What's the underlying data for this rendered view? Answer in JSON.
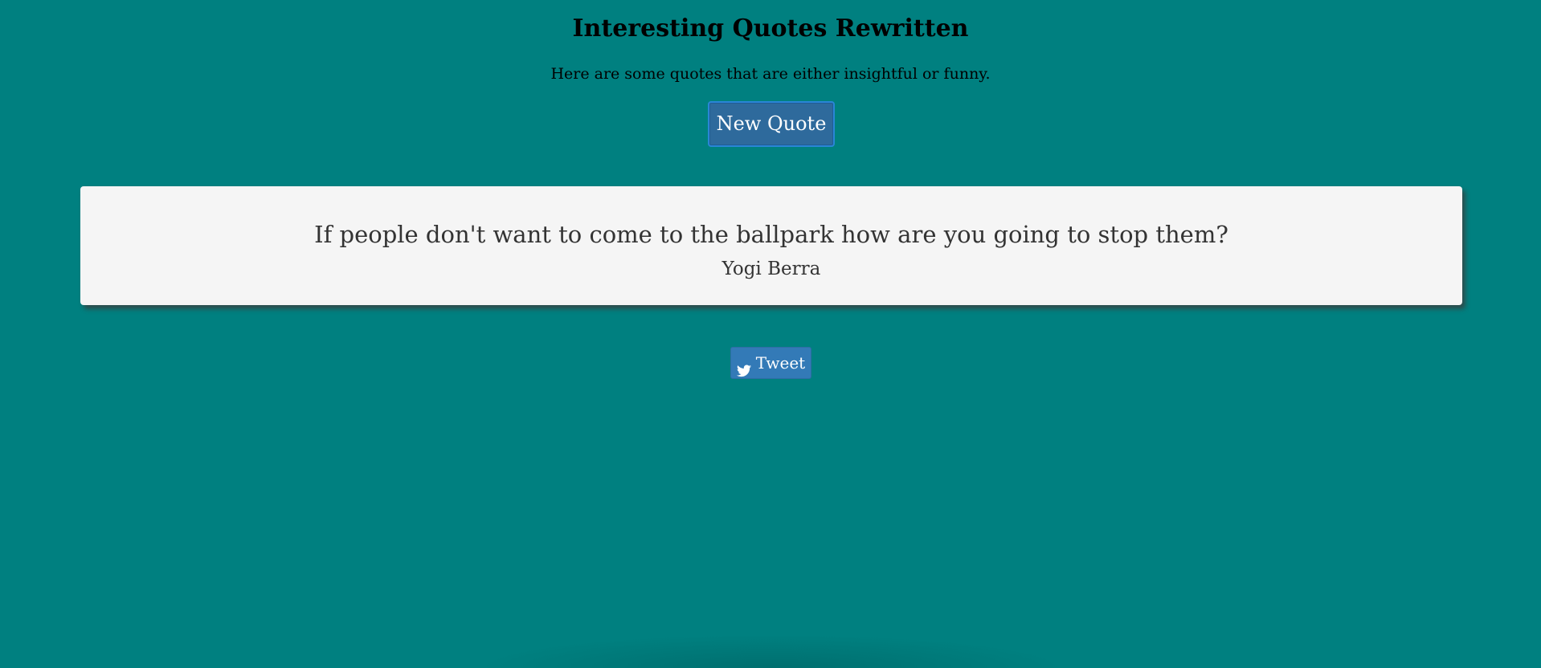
{
  "header": {
    "title": "Interesting Quotes Rewritten",
    "subtitle": "Here are some quotes that are either insightful or funny."
  },
  "controls": {
    "new_quote_label": "New Quote",
    "tweet_label": "Tweet",
    "tweet_icon": "twitter-bird-icon"
  },
  "quote": {
    "text": "If people don't want to come to the ballpark how are you going to stop them?",
    "author": "Yogi Berra"
  },
  "colors": {
    "background": "#008080",
    "card": "#f5f5f5",
    "primary_button": "#2e6a9c",
    "tweet_button": "#337ab7"
  }
}
